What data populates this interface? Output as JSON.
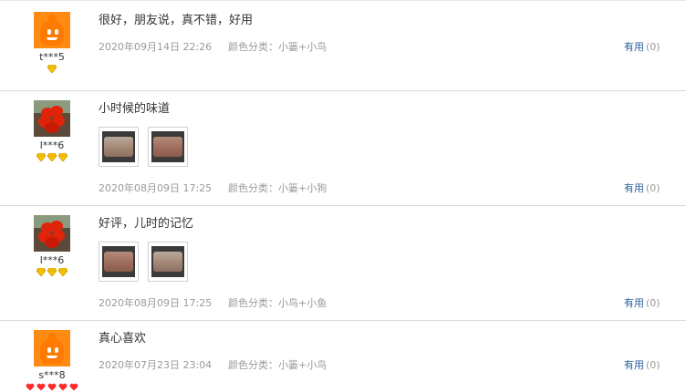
{
  "useful_label": "有用",
  "reviews": [
    {
      "username": "t***5",
      "rank": "1-gem",
      "avatar": "orange-mascot",
      "text": "很好，朋友说，真不错，好用",
      "date": "2020年09月14日 22:26",
      "variant": "颜色分类：小篓+小鸟",
      "useful_count": "(0)"
    },
    {
      "username": "l***6",
      "rank": "3-gem",
      "avatar": "red-flower",
      "text": "小时候的味道",
      "photos": [
        "cookie-tray-photo",
        "cookie-tray-photo"
      ],
      "date": "2020年08月09日 17:25",
      "variant": "颜色分类：小篓+小狗",
      "useful_count": "(0)"
    },
    {
      "username": "l***6",
      "rank": "3-gem",
      "avatar": "red-flower",
      "text": "好评，儿时的记忆",
      "photos": [
        "cookie-tray-photo",
        "cookie-tray-photo"
      ],
      "date": "2020年08月09日 17:25",
      "variant": "颜色分类：小鸟+小鱼",
      "useful_count": "(0)"
    },
    {
      "username": "s***8",
      "rank": "5-heart",
      "avatar": "orange-mascot",
      "text": "真心喜欢",
      "date": "2020年07月23日 23:04",
      "variant": "颜色分类：小篓+小鸟",
      "useful_count": "(0)"
    }
  ]
}
